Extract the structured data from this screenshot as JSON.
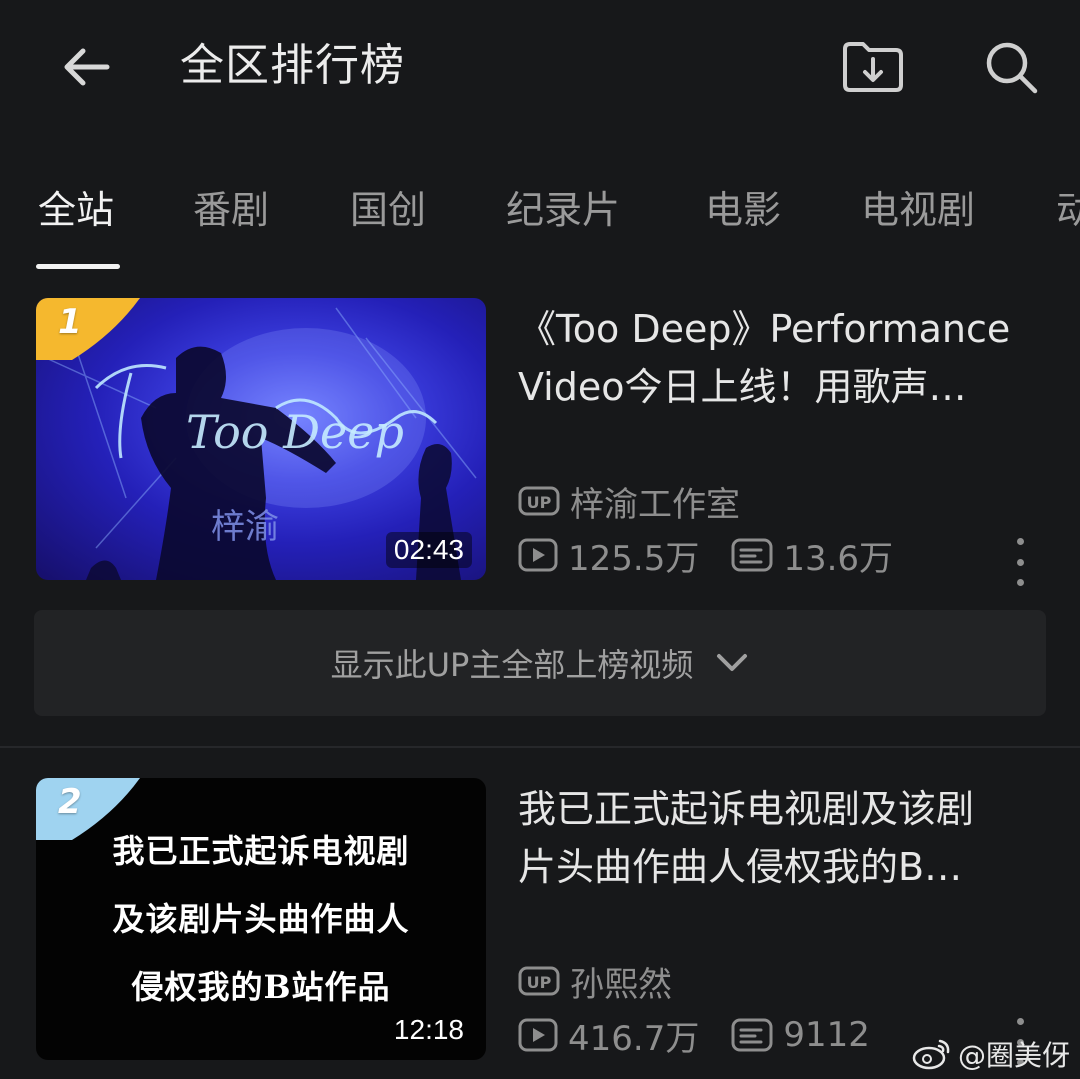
{
  "header": {
    "title": "全区排行榜",
    "back_icon": "arrow-left-icon",
    "download_icon": "folder-download-icon",
    "search_icon": "search-icon"
  },
  "tabs": [
    {
      "label": "全站",
      "active": true
    },
    {
      "label": "番剧",
      "active": false
    },
    {
      "label": "国创",
      "active": false
    },
    {
      "label": "纪录片",
      "active": false
    },
    {
      "label": "电影",
      "active": false
    },
    {
      "label": "电视剧",
      "active": false
    },
    {
      "label": "动",
      "active": false
    }
  ],
  "videos": [
    {
      "rank": "1",
      "rank_color": "#f5b82e",
      "title_line1": "《Too Deep》Performance",
      "title_line2": "Video今日上线！用歌声…",
      "duration": "02:43",
      "uploader": "梓渝工作室",
      "views": "125.5万",
      "danmaku": "13.6万",
      "thumb_script_text": "Too Deep",
      "thumb_signature": "梓渝"
    },
    {
      "rank": "2",
      "rank_color": "#9fd3f0",
      "title_line1": "我已正式起诉电视剧及该剧",
      "title_line2": "片头曲作曲人侵权我的B…",
      "duration": "12:18",
      "uploader": "孙熙然",
      "views": "416.7万",
      "danmaku": "9112",
      "thumb_text": [
        "我已正式起诉电视剧",
        "及该剧片头曲作曲人",
        "侵权我的B站作品"
      ]
    }
  ],
  "expand": {
    "label": "显示此UP主全部上榜视频"
  },
  "watermark": {
    "text": "@圈美伢"
  }
}
